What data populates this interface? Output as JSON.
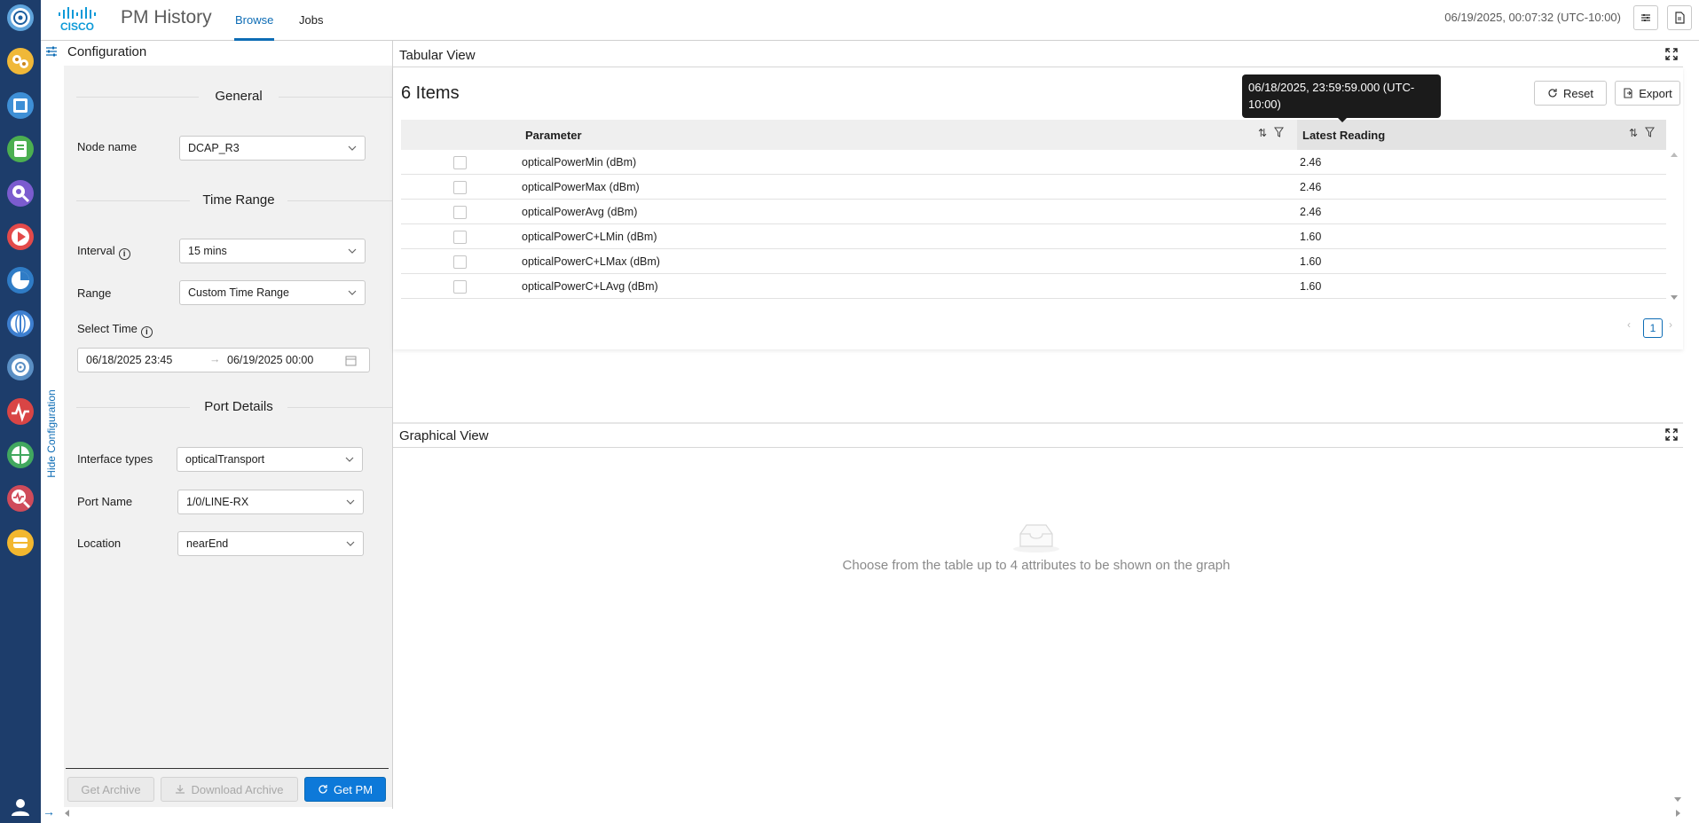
{
  "header": {
    "app_title": "PM History",
    "tabs": [
      {
        "label": "Browse"
      },
      {
        "label": "Jobs"
      }
    ],
    "datetime": "06/19/2025, 00:07:32 (UTC-10:00)",
    "logo_text": "CISCO"
  },
  "sidebar": {
    "hide_config_label": "Hide Configuration",
    "rail_icons": [
      "nav-app-icon-1",
      "nav-app-icon-2",
      "nav-app-icon-3",
      "nav-app-icon-4",
      "nav-app-icon-5",
      "nav-app-icon-6",
      "nav-app-icon-7",
      "nav-app-icon-8",
      "nav-app-icon-9",
      "nav-app-icon-10",
      "nav-app-icon-11",
      "nav-app-icon-12",
      "nav-app-icon-13",
      "user-icon"
    ]
  },
  "config": {
    "title": "Configuration",
    "general_heading": "General",
    "node_name_label": "Node name",
    "node_name_value": "DCAP_R3",
    "time_range_heading": "Time Range",
    "interval_label": "Interval",
    "interval_value": "15 mins",
    "range_label": "Range",
    "range_value": "Custom Time Range",
    "select_time_label": "Select Time",
    "start_time": "06/18/2025 23:45",
    "end_time": "06/19/2025 00:00",
    "port_details_heading": "Port Details",
    "interface_types_label": "Interface types",
    "interface_types_value": "opticalTransport",
    "port_name_label": "Port Name",
    "port_name_value": "1/0/LINE-RX",
    "location_label": "Location",
    "location_value": "nearEnd",
    "buttons": {
      "get_archive": "Get Archive",
      "download_archive": "Download Archive",
      "get_pm": "Get PM"
    }
  },
  "tabular": {
    "title": "Tabular View",
    "items_count": "6 Items",
    "reset_label": "Reset",
    "export_label": "Export",
    "columns": [
      "Parameter",
      "Latest Reading"
    ],
    "rows": [
      {
        "parameter": "opticalPowerMin (dBm)",
        "value": "2.46"
      },
      {
        "parameter": "opticalPowerMax (dBm)",
        "value": "2.46"
      },
      {
        "parameter": "opticalPowerAvg (dBm)",
        "value": "2.46"
      },
      {
        "parameter": "opticalPowerC+LMin (dBm)",
        "value": "1.60"
      },
      {
        "parameter": "opticalPowerC+LMax (dBm)",
        "value": "1.60"
      },
      {
        "parameter": "opticalPowerC+LAvg (dBm)",
        "value": "1.60"
      }
    ],
    "page": "1",
    "tooltip": "06/18/2025, 23:59:59.000 (UTC-10:00)"
  },
  "graphical": {
    "title": "Graphical View",
    "empty_message": "Choose from the table up to 4 attributes to be shown on the graph"
  },
  "colors": {
    "rail": "#1d3d6b",
    "accent": "#0d6cb5",
    "primary_button": "#0d79d9"
  }
}
